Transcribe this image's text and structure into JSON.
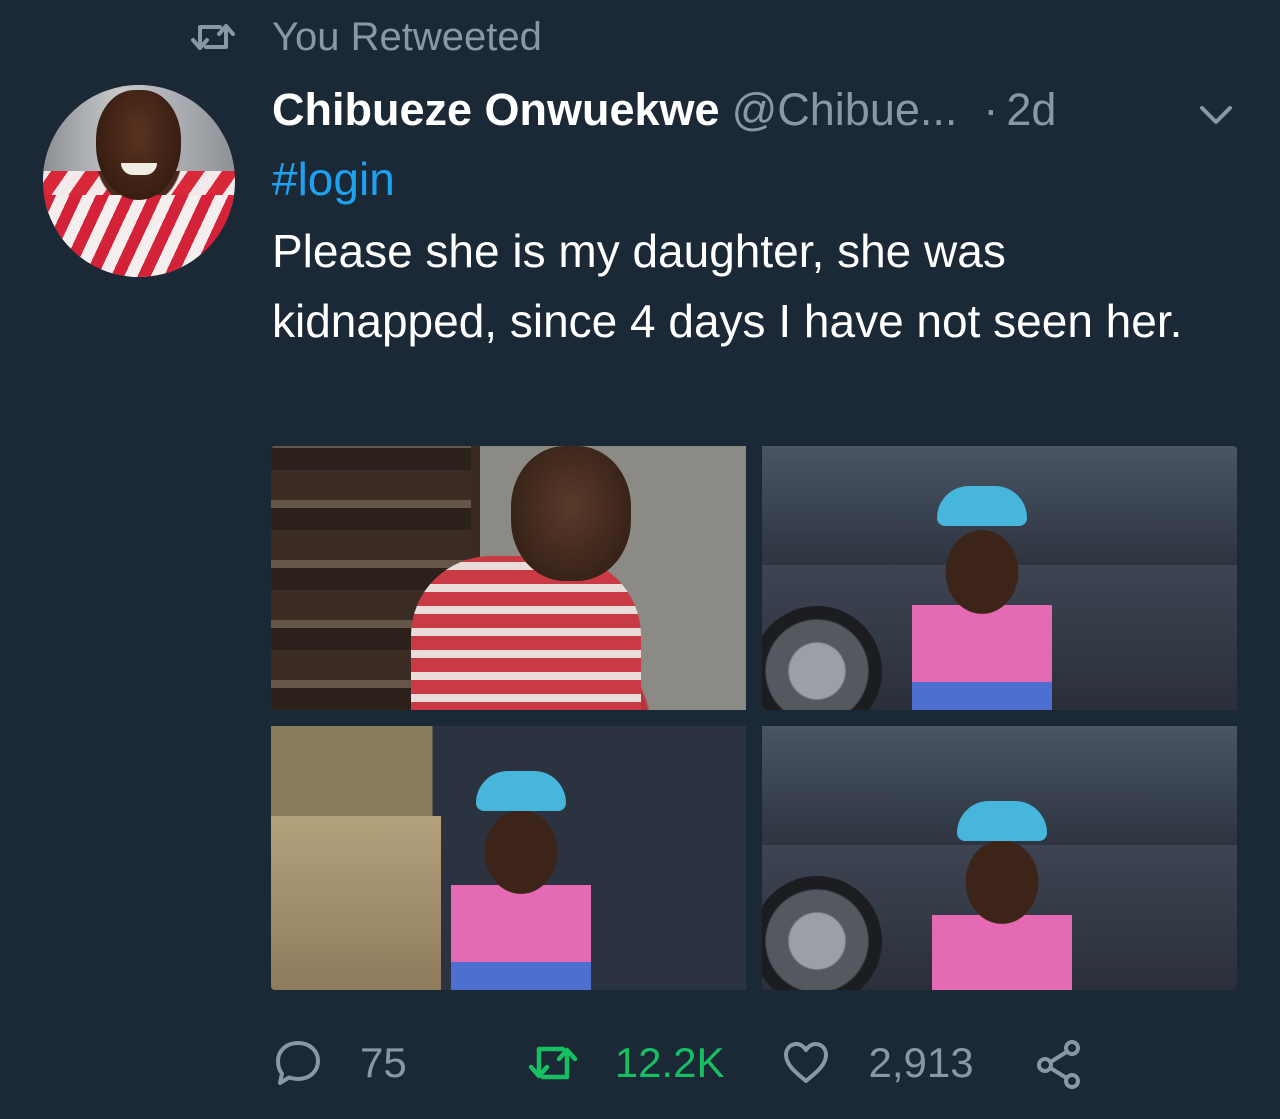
{
  "retweet_context": {
    "label": "You Retweeted",
    "icon": "retweet-icon"
  },
  "tweet": {
    "author_name": "Chibueze Onwuekwe",
    "author_handle": "@Chibue...",
    "separator": "·",
    "time": "2d",
    "hashtag": "#login",
    "text": "Please she is my daughter, she was kidnapped, since 4 days I have not seen her.",
    "media": [
      {
        "icon": "photo-boy-striped-shirt"
      },
      {
        "icon": "photo-girl-by-car"
      },
      {
        "icon": "photo-girl-by-car-outdoor"
      },
      {
        "icon": "photo-girl-by-car-wave"
      }
    ]
  },
  "actions": {
    "reply_count": "75",
    "retweet_count": "12.2K",
    "like_count": "2,913"
  },
  "colors": {
    "background": "#1b2836",
    "secondary_text": "#8899a6",
    "link": "#1da1f2",
    "retweeted": "#17bf63"
  }
}
